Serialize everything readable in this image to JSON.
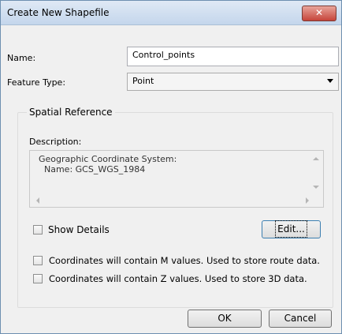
{
  "dialog": {
    "title": "Create New Shapefile",
    "close_label": "✕"
  },
  "name": {
    "label": "Name:",
    "value": "Control_points"
  },
  "feature_type": {
    "label": "Feature Type:",
    "value": "Point"
  },
  "spatial_reference": {
    "legend": "Spatial Reference",
    "description_label": "Description:",
    "description_text": "Geographic Coordinate System:\n  Name: GCS_WGS_1984",
    "show_details_label": "Show Details",
    "edit_label": "Edit..."
  },
  "options": {
    "m_values_label": "Coordinates will contain M values. Used to store route data.",
    "z_values_label": "Coordinates will contain Z values. Used to store 3D data."
  },
  "buttons": {
    "ok_label": "OK",
    "cancel_label": "Cancel"
  }
}
